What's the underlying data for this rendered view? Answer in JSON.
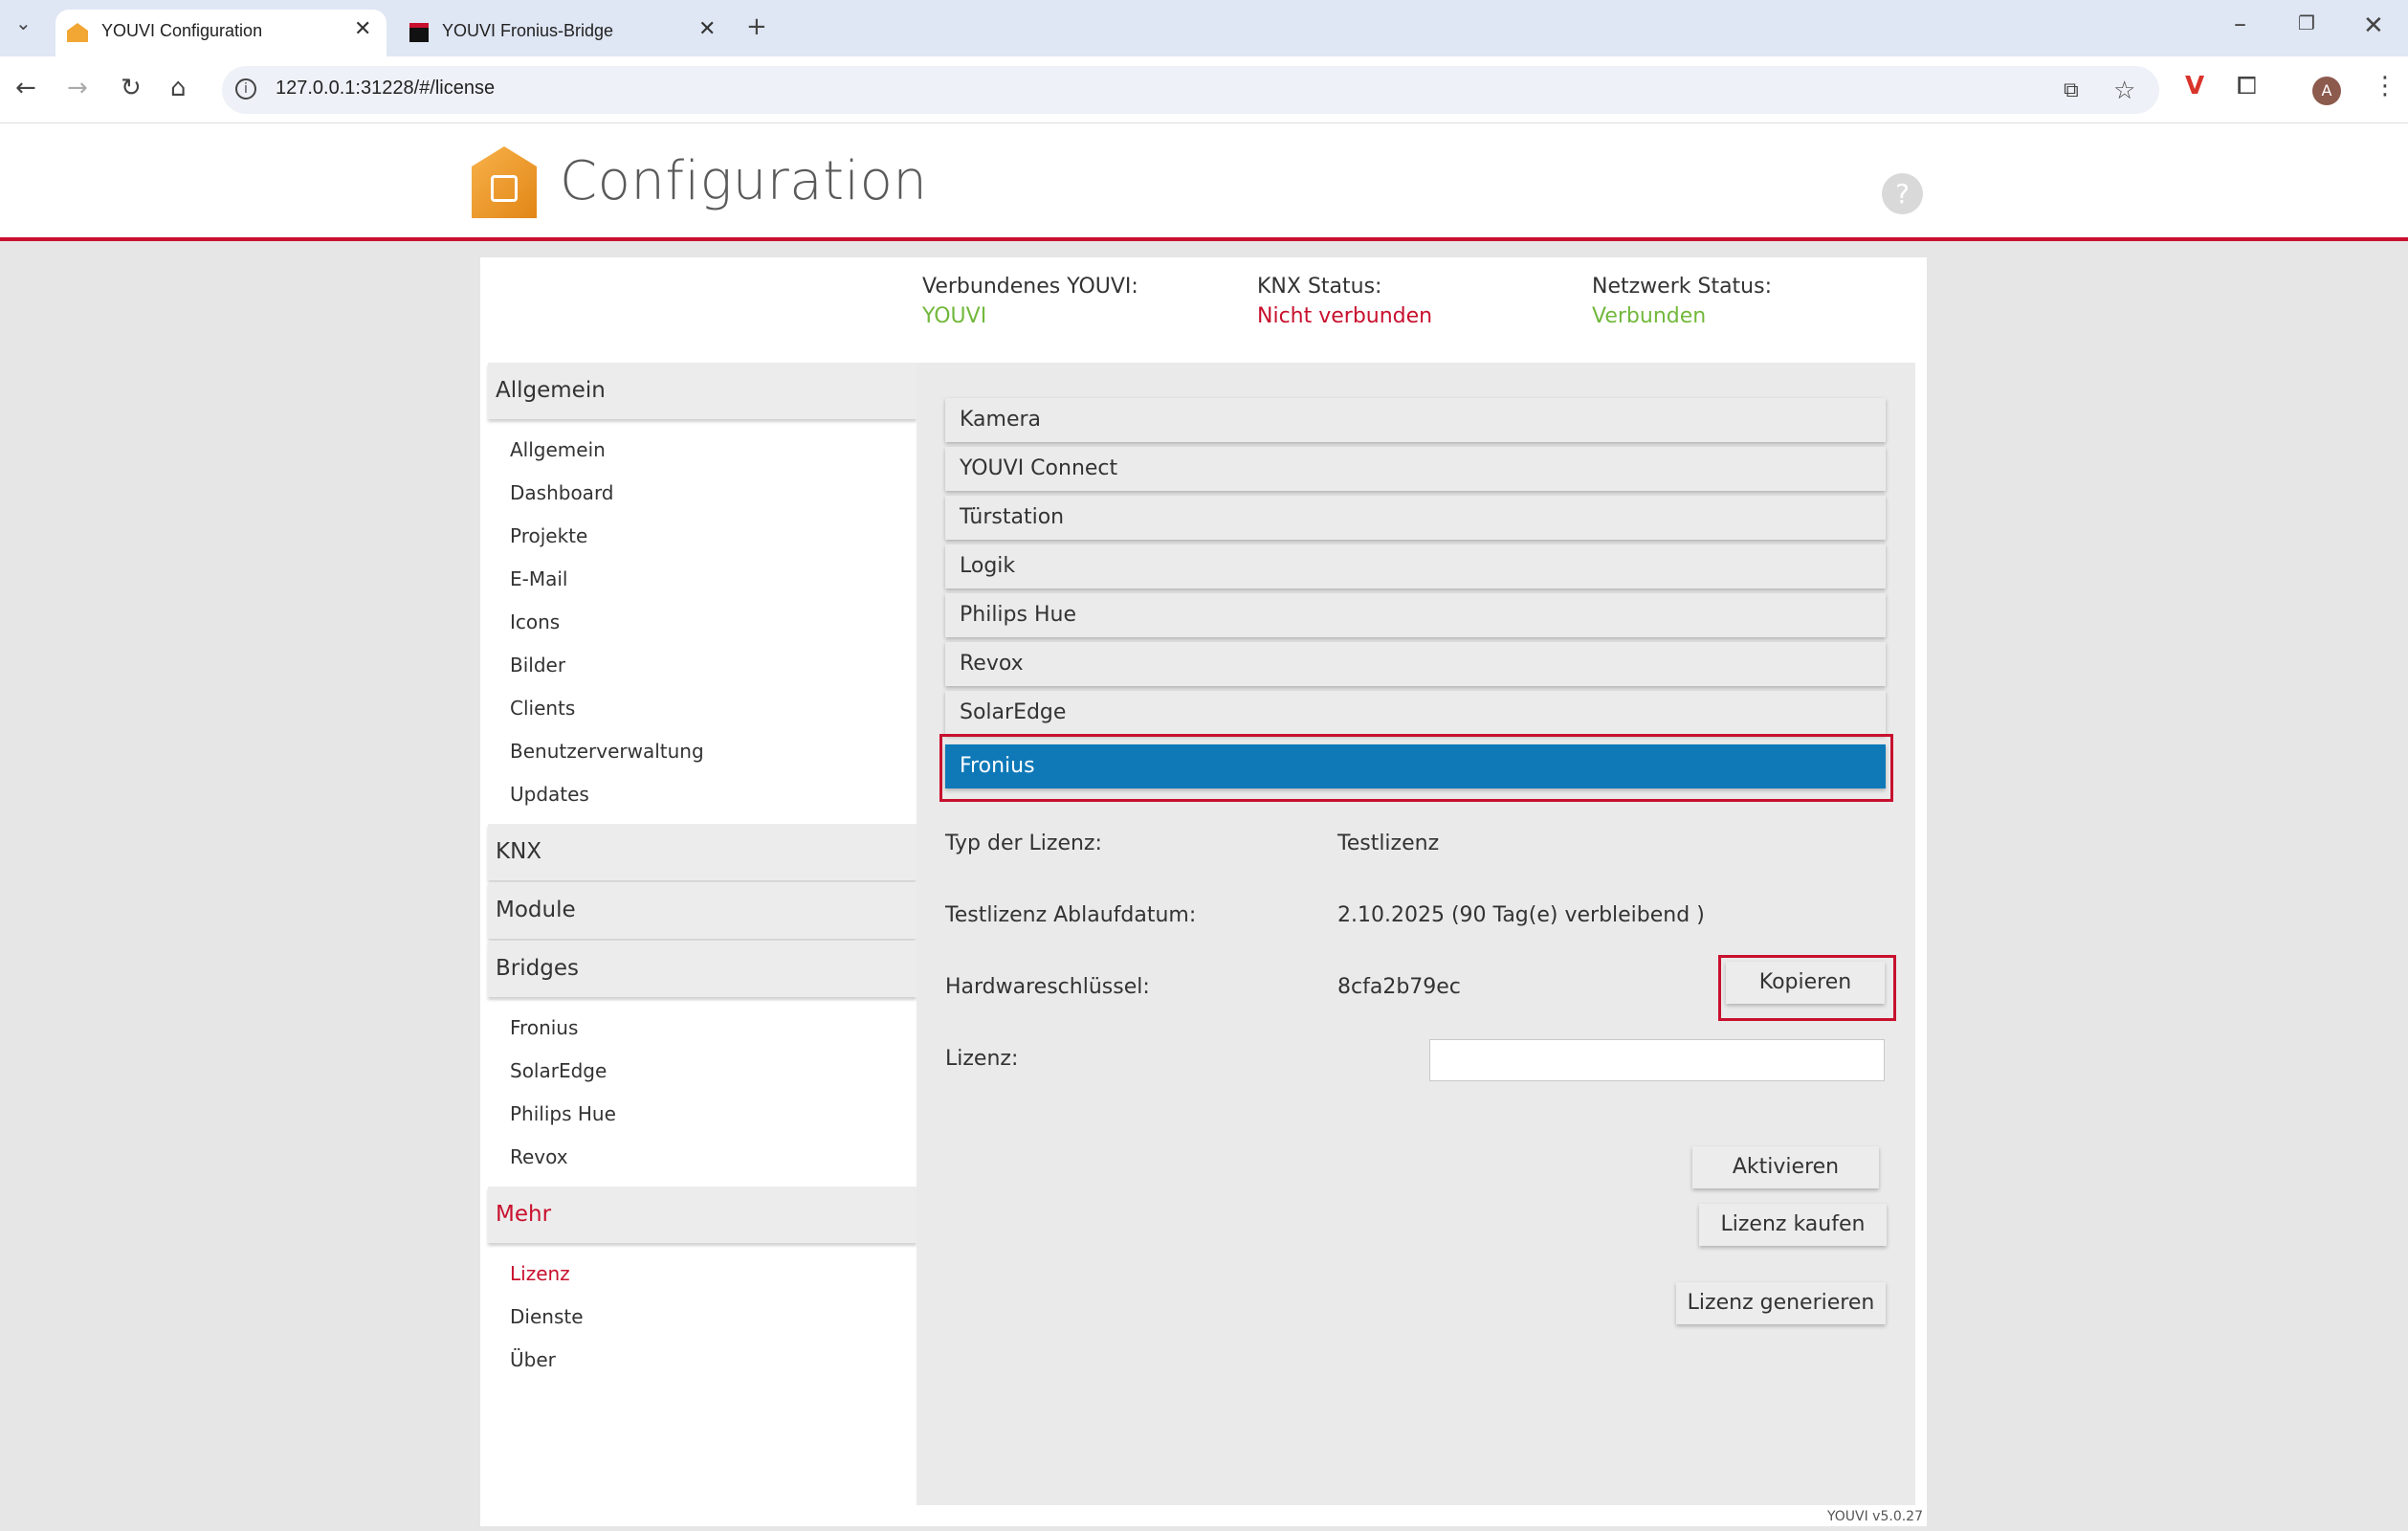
{
  "browser": {
    "tabs": [
      {
        "title": "YOUVI Configuration",
        "active": true,
        "icon": "youvi-house-icon"
      },
      {
        "title": "YOUVI Fronius-Bridge",
        "active": false,
        "icon": "fronius-bridge-icon"
      }
    ],
    "url": "127.0.0.1:31228/#/license",
    "profile_initial": "A"
  },
  "header": {
    "title": "Configuration",
    "help_symbol": "?"
  },
  "status": {
    "youvi_label": "Verbundenes YOUVI:",
    "youvi_value": "YOUVI",
    "knx_label": "KNX Status:",
    "knx_value": "Nicht verbunden",
    "network_label": "Netzwerk Status:",
    "network_value": "Verbunden"
  },
  "sidebar": {
    "sections": [
      {
        "label": "Allgemein",
        "items": [
          "Allgemein",
          "Dashboard",
          "Projekte",
          "E-Mail",
          "Icons",
          "Bilder",
          "Clients",
          "Benutzerverwaltung",
          "Updates"
        ]
      },
      {
        "label": "KNX",
        "items": []
      },
      {
        "label": "Module",
        "items": []
      },
      {
        "label": "Bridges",
        "items": [
          "Fronius",
          "SolarEdge",
          "Philips Hue",
          "Revox"
        ]
      },
      {
        "label": "Mehr",
        "items": [
          "Lizenz",
          "Dienste",
          "Über"
        ],
        "active": true,
        "active_item": "Lizenz"
      }
    ]
  },
  "modules": [
    "Kamera",
    "YOUVI Connect",
    "Türstation",
    "Logik",
    "Philips Hue",
    "Revox",
    "SolarEdge",
    "Fronius"
  ],
  "selected_module": "Fronius",
  "license": {
    "type_label": "Typ der Lizenz:",
    "type_value": "Testlizenz",
    "expiry_label": "Testlizenz Ablaufdatum:",
    "expiry_value": "2.10.2025 (90 Tag(e) verbleibend )",
    "hwkey_label": "Hardwareschlüssel:",
    "hwkey_value": "8cfa2b79ec",
    "copy_button": "Kopieren",
    "license_label": "Lizenz:",
    "license_value": "",
    "activate_button": "Aktivieren",
    "buy_button": "Lizenz kaufen",
    "generate_button": "Lizenz generieren"
  },
  "footer": {
    "version": "YOUVI v5.0.27"
  },
  "colors": {
    "accent_red": "#c8102e",
    "selected_blue": "#0f79b8",
    "status_green": "#72b83c"
  }
}
